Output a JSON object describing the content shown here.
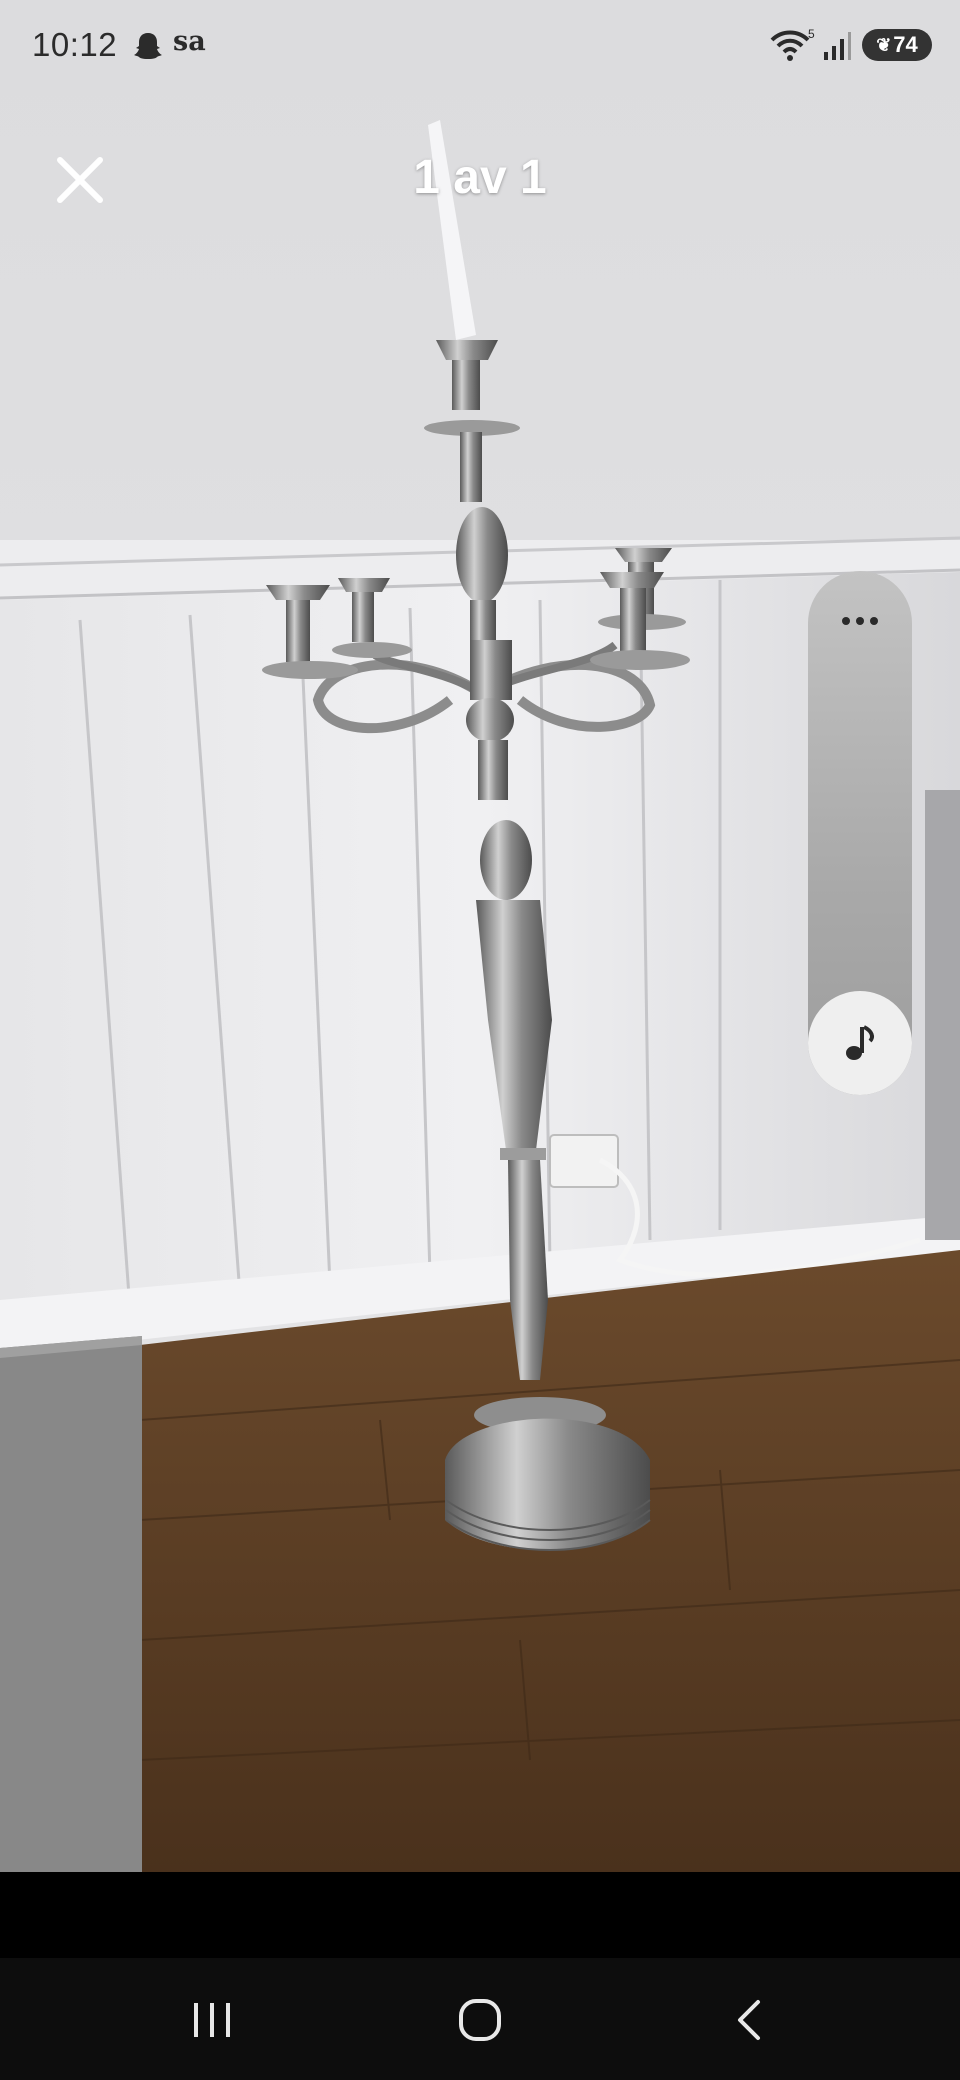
{
  "status_bar": {
    "time": "10:12",
    "carrier": "sa",
    "wifi_label": "5",
    "battery_level": "74",
    "notification_icon": "snapchat-ghost-icon"
  },
  "viewer": {
    "title": "1 av 1",
    "close_icon": "close-icon",
    "more_icon": "more-horizontal-icon",
    "music_icon": "music-note-icon"
  },
  "nav": {
    "recents_icon": "recents-icon",
    "home_icon": "home-icon",
    "back_icon": "back-icon"
  },
  "colors": {
    "wall": "#e2e2e4",
    "floor": "#5e4026",
    "rug": "#8a8a8a",
    "nav_bg": "#0d0d0d"
  }
}
